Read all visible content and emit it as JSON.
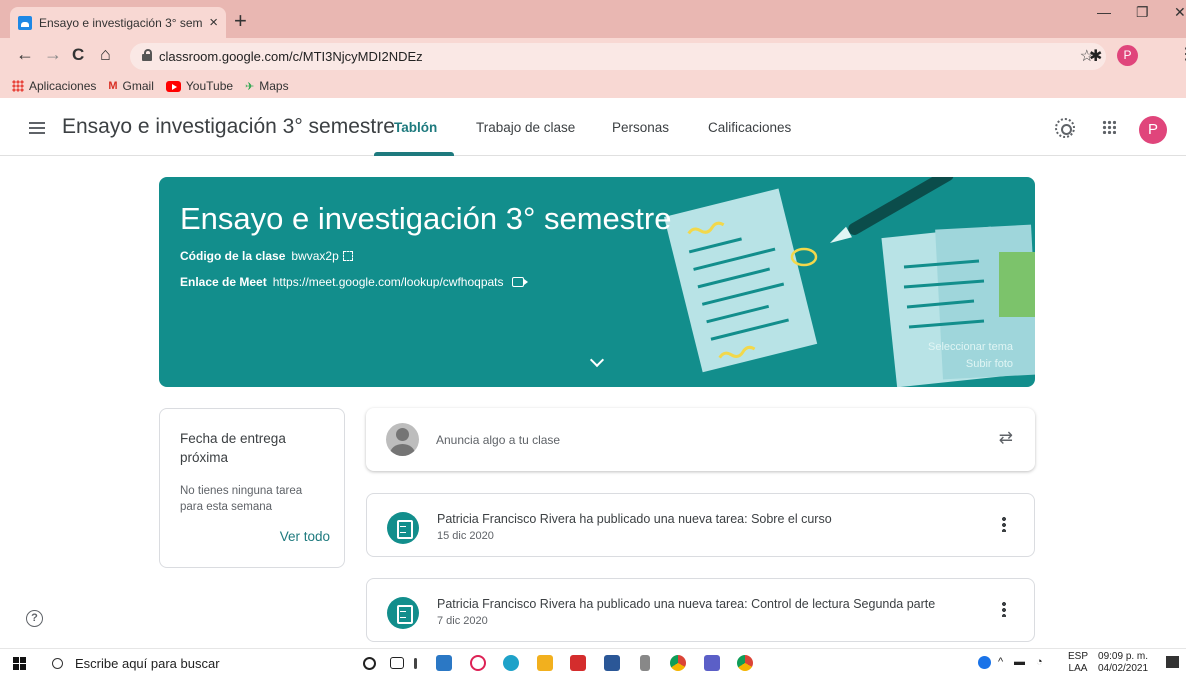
{
  "browser": {
    "tab_title": "Ensayo e investigación 3° semest",
    "url": "classroom.google.com/c/MTI3NjcyMDI2NDEz",
    "profile_initial": "P",
    "bookmarks": [
      {
        "label": "Aplicaciones"
      },
      {
        "label": "Gmail"
      },
      {
        "label": "YouTube"
      },
      {
        "label": "Maps"
      }
    ]
  },
  "header": {
    "course_title": "Ensayo e investigación 3° semestre",
    "tabs": [
      {
        "label": "Tablón"
      },
      {
        "label": "Trabajo de clase"
      },
      {
        "label": "Personas"
      },
      {
        "label": "Calificaciones"
      }
    ],
    "avatar_initial": "P"
  },
  "banner": {
    "title": "Ensayo e investigación 3° semestre",
    "code_label": "Código de la clase",
    "code_value": "bwvax2p",
    "meet_label": "Enlace de Meet",
    "meet_value": "https://meet.google.com/lookup/cwfhoqpats",
    "select_theme": "Seleccionar tema",
    "upload_photo": "Subir foto"
  },
  "upcoming": {
    "title": "Fecha de entrega próxima",
    "message": "No tienes ninguna tarea para esta semana",
    "see_all": "Ver todo"
  },
  "announce": {
    "placeholder": "Anuncia algo a tu clase"
  },
  "posts": [
    {
      "title": "Patricia Francisco Rivera ha publicado una nueva tarea: Sobre el curso",
      "date": "15 dic 2020"
    },
    {
      "title": "Patricia Francisco Rivera ha publicado una nueva tarea: Control de lectura Segunda parte",
      "date": "7 dic 2020"
    }
  ],
  "help_symbol": "?",
  "taskbar": {
    "search_placeholder": "Escribe aquí para buscar",
    "lang_line1": "ESP",
    "lang_line2": "LAA",
    "time": "09:09 p. m.",
    "date": "04/02/2021"
  },
  "colors": {
    "accent": "#1e7a7e",
    "banner": "#128e8c",
    "chrome": "#e9b7b2",
    "avatar": "#e0457b"
  }
}
